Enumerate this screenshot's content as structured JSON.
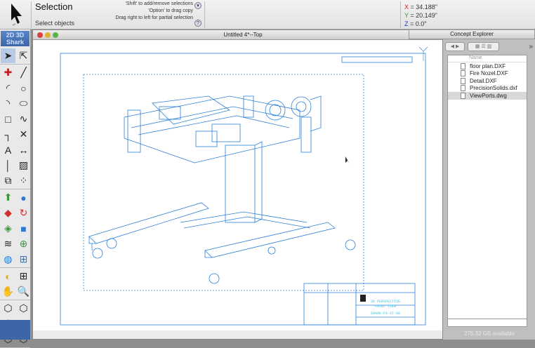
{
  "toolbar": {
    "mode_title": "Selection",
    "mode_description": "Select objects",
    "hints": [
      "'Shift' to add/remove selections",
      "'Option' to drag copy",
      "Drag right to left for partial selection"
    ],
    "help_label": "?",
    "menu_label": "▾"
  },
  "coords": {
    "x_label": "X",
    "x_value": "= 34.188\"",
    "y_label": "Y",
    "y_value": "= 20.149\"",
    "z_label": "Z",
    "z_value": "= 0.0\"",
    "colors": {
      "x": "#d02020",
      "y": "#2a9a2a",
      "z": "#2233cc"
    }
  },
  "palette": {
    "brand_top": "2D 3D",
    "brand_bottom": "Shark",
    "tools": [
      "selection",
      "direct-select",
      "point",
      "line",
      "arc",
      "circle",
      "fillet-arc",
      "ellipse",
      "rectangle",
      "spline",
      "fillet",
      "trim",
      "text",
      "dimension",
      "vertical-line",
      "hatch",
      "scale",
      "array",
      "extrude",
      "sphere",
      "push-pull",
      "revolve",
      "sweep",
      "box",
      "loft",
      "boolean",
      "shell",
      "solid-add",
      "light",
      "viewports",
      "pan",
      "zoom",
      "view-iso1",
      "view-iso2",
      "view-iso3",
      "view-shaded",
      "view-wire",
      "view-hidden"
    ]
  },
  "document": {
    "title": "Untitled 4*--Top",
    "accent": "#2b7fd8",
    "title_block": {
      "title_line1": "3D PERSPECTIVE",
      "title_line2": "FRONT VIEW",
      "drawing_no": "SHARK-FX-ST-08"
    }
  },
  "explorer": {
    "title": "Concept Explorer",
    "column": "Name",
    "more": "»",
    "files": [
      {
        "name": "floor plan.DXF"
      },
      {
        "name": "Fire Nozel.DXF"
      },
      {
        "name": "Detail.DXF"
      },
      {
        "name": "PrecisionSolids.dxf"
      },
      {
        "name": "ViewPorts.dwg",
        "selected": true
      }
    ],
    "status": "275.32 GB available"
  }
}
